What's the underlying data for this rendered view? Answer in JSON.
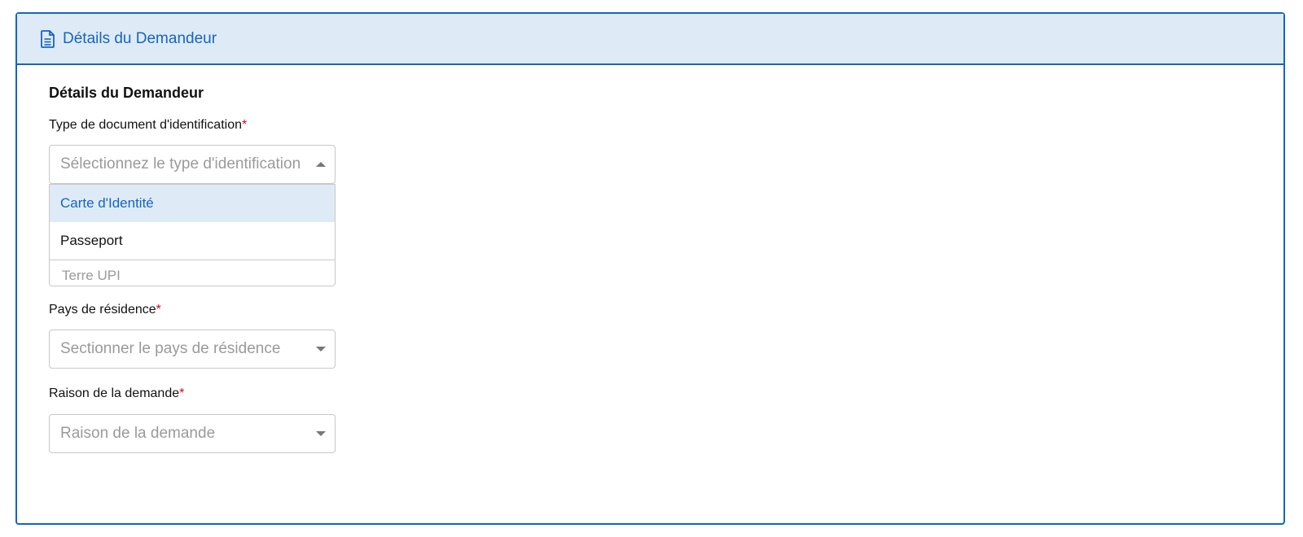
{
  "panel": {
    "header_title": "Détails du Demandeur",
    "header_icon": "document-icon",
    "accent_color": "#1565c0",
    "header_bg": "#deebf7"
  },
  "form": {
    "section_title": "Détails du Demandeur",
    "required_mark": "*",
    "id_type": {
      "label": "Type de document d'identification",
      "placeholder": "Sélectionnez le type d'identification",
      "options": [
        "Carte d'Identité",
        "Passeport"
      ],
      "highlighted_option": "Carte d'Identité"
    },
    "hidden_field_text": "Terre UPI",
    "country": {
      "label": "Pays de résidence",
      "placeholder": "Sectionner le pays de résidence"
    },
    "reason": {
      "label": "Raison de la demande",
      "placeholder": "Raison de la demande"
    }
  }
}
